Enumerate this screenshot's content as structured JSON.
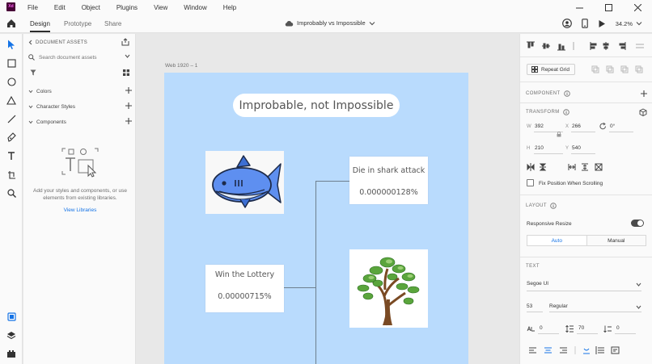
{
  "app": {
    "logo": "Xd",
    "accent": "#1473e6",
    "logo_bg": "#470137",
    "logo_fg": "#ff61f6"
  },
  "menu": [
    "File",
    "Edit",
    "Object",
    "Plugins",
    "View",
    "Window",
    "Help"
  ],
  "tabs": {
    "design": "Design",
    "prototype": "Prototype",
    "share": "Share"
  },
  "document": {
    "title": "Improbably vs Impossible"
  },
  "zoom": "34.2%",
  "assets": {
    "header": "DOCUMENT ASSETS",
    "search_placeholder": "Search document assets",
    "sections": [
      "Colors",
      "Character Styles",
      "Components"
    ],
    "empty_text": "Add your styles and components, or use elements from existing libraries.",
    "view_libraries": "View Libraries"
  },
  "canvas": {
    "artboard_label": "Web 1920 – 1",
    "artboard_color": "#b9dbfd",
    "title": "Improbable, not Impossible",
    "shark_card": {
      "title": "Die in shark attack",
      "value": "0.000000128%"
    },
    "lottery_card": {
      "title": "Win the Lottery",
      "value": "0.00000715%"
    }
  },
  "props": {
    "repeat_grid": "Repeat Grid",
    "component_label": "COMPONENT",
    "transform_label": "TRANSFORM",
    "w_label": "W",
    "w": "392",
    "x_label": "X",
    "x": "266",
    "rotation": "0°",
    "h_label": "H",
    "h": "210",
    "y_label": "Y",
    "y": "540",
    "fix_position": "Fix Position When Scrolling",
    "layout_label": "LAYOUT",
    "responsive_resize": "Responsive Resize",
    "auto": "Auto",
    "manual": "Manual",
    "text_label": "TEXT",
    "font": "Segoe UI",
    "font_size": "53",
    "font_weight": "Regular",
    "char_spacing": "0",
    "line_spacing": "70",
    "para_spacing": "0"
  }
}
